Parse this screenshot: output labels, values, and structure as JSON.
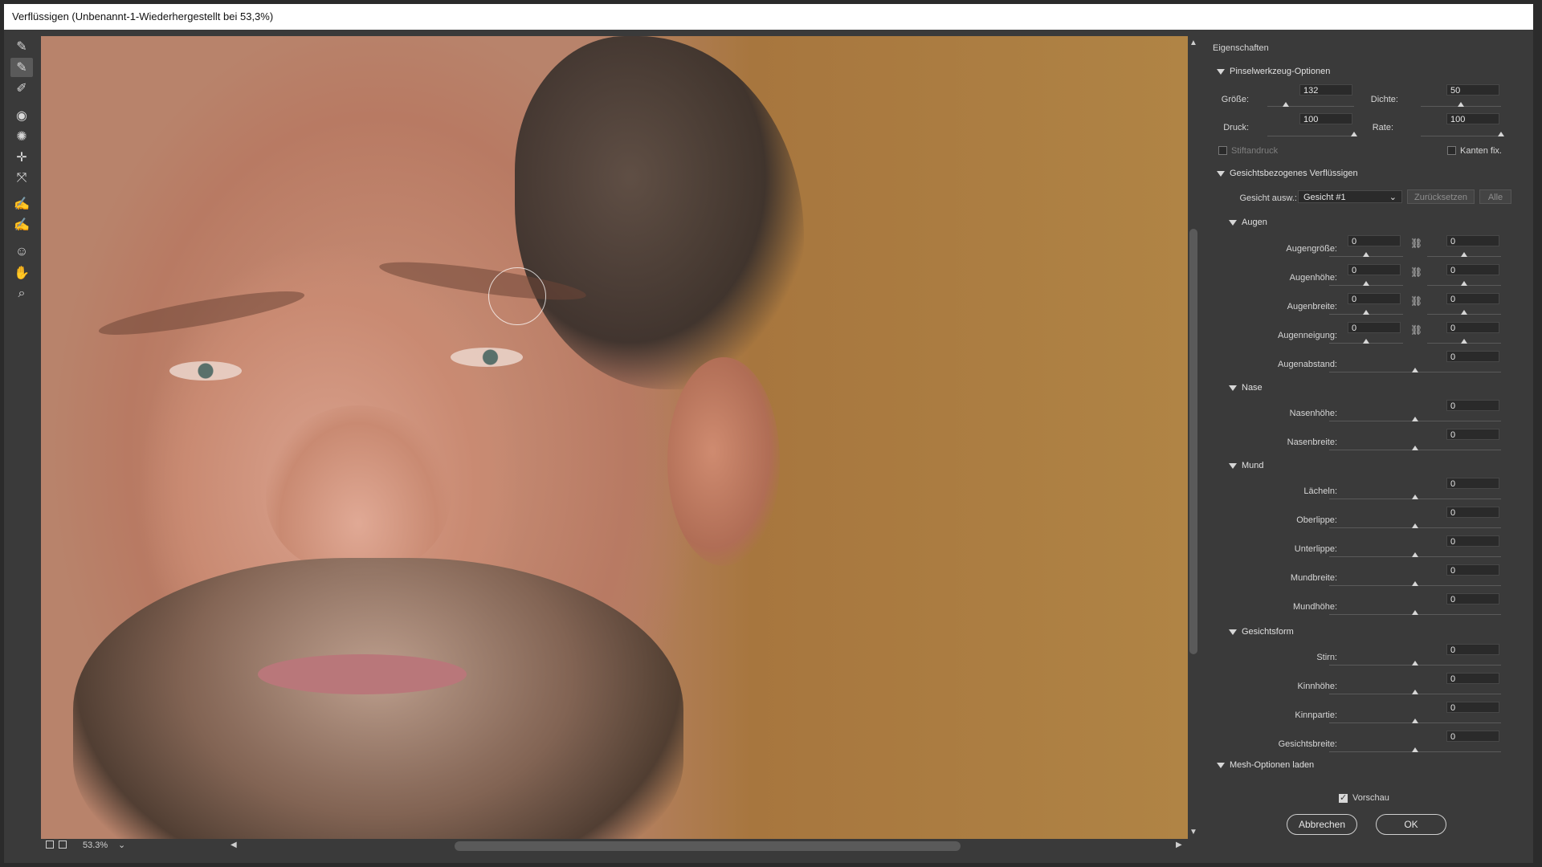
{
  "window": {
    "title": "Verflüssigen (Unbenannt-1-Wiederhergestellt bei 53,3%)"
  },
  "toolbar": {
    "tools": [
      {
        "name": "forward-warp-tool",
        "icon": "brush-icon"
      },
      {
        "name": "reconstruct-tool",
        "icon": "brush-icon",
        "active": true
      },
      {
        "name": "smooth-tool",
        "icon": "smooth-icon"
      },
      {
        "name": "twirl-tool",
        "icon": "twirl-icon"
      },
      {
        "name": "pucker-tool",
        "icon": "pucker-icon"
      },
      {
        "name": "bloat-tool",
        "icon": "bloat-icon"
      },
      {
        "name": "push-left-tool",
        "icon": "push-icon"
      },
      {
        "name": "freeze-mask-tool",
        "icon": "freeze-icon"
      },
      {
        "name": "thaw-mask-tool",
        "icon": "thaw-icon"
      },
      {
        "name": "face-tool",
        "icon": "face-icon"
      },
      {
        "name": "hand-tool",
        "icon": "hand-icon"
      },
      {
        "name": "zoom-tool",
        "icon": "zoom-icon"
      }
    ]
  },
  "canvas_footer": {
    "zoom": "53.3%"
  },
  "panel": {
    "title": "Eigenschaften",
    "brush": {
      "header": "Pinselwerkzeug-Optionen",
      "groesse_label": "Größe:",
      "groesse": "132",
      "dichte_label": "Dichte:",
      "dichte": "50",
      "druck_label": "Druck:",
      "druck": "100",
      "rate_label": "Rate:",
      "rate": "100",
      "stift_label": "Stiftandruck",
      "kanten_label": "Kanten fix."
    },
    "face": {
      "header": "Gesichtsbezogenes Verflüssigen",
      "select_label": "Gesicht ausw.:",
      "select_value": "Gesicht #1",
      "reset_label": "Zurücksetzen",
      "all_label": "Alle"
    },
    "augen": {
      "header": "Augen",
      "rows": [
        {
          "label": "Augengröße:",
          "left": "0",
          "right": "0"
        },
        {
          "label": "Augenhöhe:",
          "left": "0",
          "right": "0"
        },
        {
          "label": "Augenbreite:",
          "left": "0",
          "right": "0"
        },
        {
          "label": "Augenneigung:",
          "left": "0",
          "right": "0"
        },
        {
          "label": "Augenabstand:",
          "right": "0"
        }
      ]
    },
    "nase": {
      "header": "Nase",
      "rows": [
        {
          "label": "Nasenhöhe:",
          "value": "0"
        },
        {
          "label": "Nasenbreite:",
          "value": "0"
        }
      ]
    },
    "mund": {
      "header": "Mund",
      "rows": [
        {
          "label": "Lächeln:",
          "value": "0"
        },
        {
          "label": "Oberlippe:",
          "value": "0"
        },
        {
          "label": "Unterlippe:",
          "value": "0"
        },
        {
          "label": "Mundbreite:",
          "value": "0"
        },
        {
          "label": "Mundhöhe:",
          "value": "0"
        }
      ]
    },
    "gesichtsform": {
      "header": "Gesichtsform",
      "rows": [
        {
          "label": "Stirn:",
          "value": "0"
        },
        {
          "label": "Kinnhöhe:",
          "value": "0"
        },
        {
          "label": "Kinnpartie:",
          "value": "0"
        },
        {
          "label": "Gesichtsbreite:",
          "value": "0"
        }
      ]
    },
    "mesh": {
      "header": "Mesh-Optionen laden"
    },
    "preview_label": "Vorschau",
    "cancel_label": "Abbrechen",
    "ok_label": "OK"
  }
}
